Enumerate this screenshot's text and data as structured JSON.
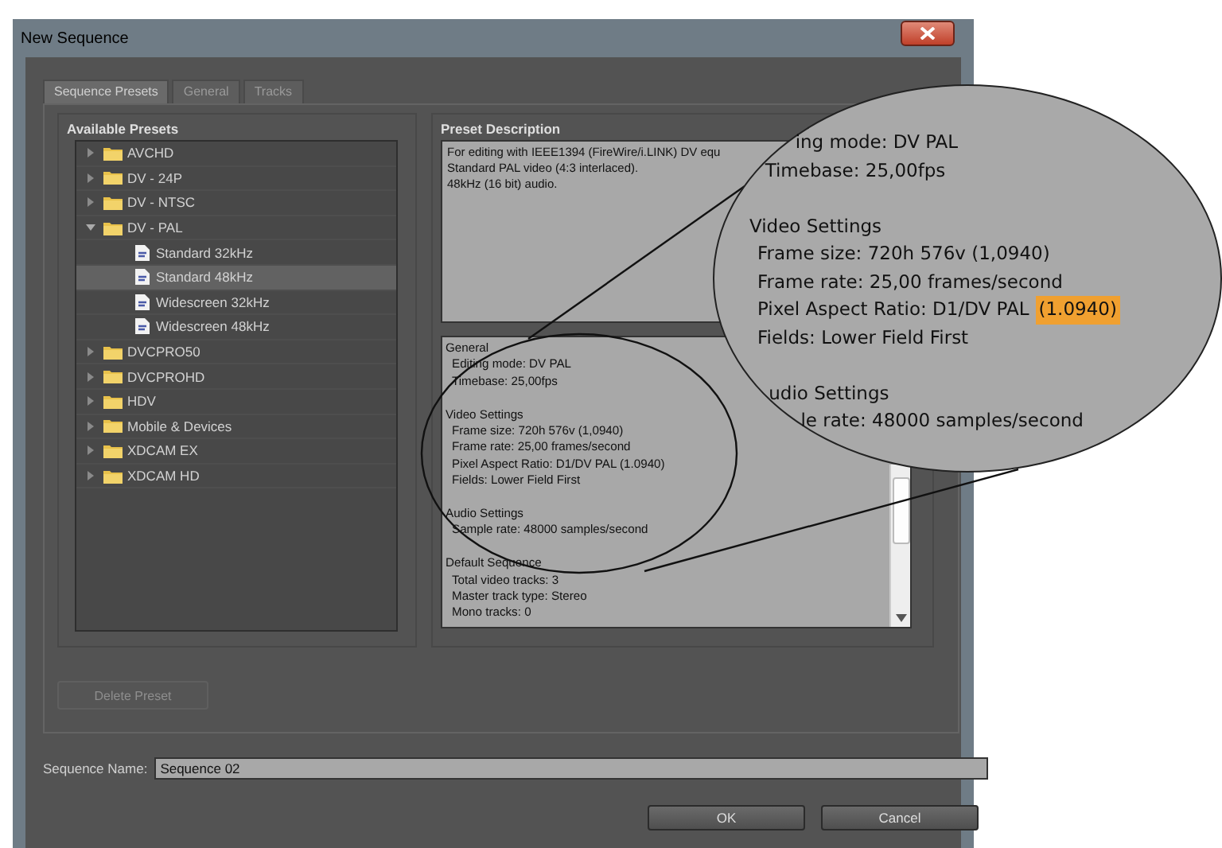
{
  "window": {
    "title": "New Sequence"
  },
  "tabs": [
    {
      "label": "Sequence Presets",
      "selected": true
    },
    {
      "label": "General",
      "selected": false
    },
    {
      "label": "Tracks",
      "selected": false
    }
  ],
  "presets": {
    "heading": "Available Presets",
    "tree": [
      {
        "kind": "folder",
        "label": "AVCHD",
        "expanded": false,
        "selected": false
      },
      {
        "kind": "folder",
        "label": "DV - 24P",
        "expanded": false,
        "selected": false
      },
      {
        "kind": "folder",
        "label": "DV - NTSC",
        "expanded": false,
        "selected": false
      },
      {
        "kind": "folder",
        "label": "DV - PAL",
        "expanded": true,
        "selected": false,
        "children": [
          {
            "kind": "preset",
            "label": "Standard 32kHz",
            "selected": false
          },
          {
            "kind": "preset",
            "label": "Standard 48kHz",
            "selected": true
          },
          {
            "kind": "preset",
            "label": "Widescreen 32kHz",
            "selected": false
          },
          {
            "kind": "preset",
            "label": "Widescreen 48kHz",
            "selected": false
          }
        ]
      },
      {
        "kind": "folder",
        "label": "DVCPRO50",
        "expanded": false,
        "selected": false
      },
      {
        "kind": "folder",
        "label": "DVCPROHD",
        "expanded": false,
        "selected": false
      },
      {
        "kind": "folder",
        "label": "HDV",
        "expanded": false,
        "selected": false
      },
      {
        "kind": "folder",
        "label": "Mobile & Devices",
        "expanded": false,
        "selected": false
      },
      {
        "kind": "folder",
        "label": "XDCAM EX",
        "expanded": false,
        "selected": false
      },
      {
        "kind": "folder",
        "label": "XDCAM HD",
        "expanded": false,
        "selected": false
      }
    ]
  },
  "description": {
    "heading": "Preset Description",
    "summary": [
      "For editing with IEEE1394 (FireWire/i.LINK) DV equ",
      "Standard PAL video (4:3 interlaced).",
      "48kHz (16 bit) audio."
    ],
    "details": [
      {
        "heading": "General",
        "entries": [
          "Editing mode: DV PAL",
          "Timebase: 25,00fps"
        ]
      },
      {
        "heading": "Video Settings",
        "entries": [
          "Frame size: 720h 576v (1,0940)",
          "Frame rate: 25,00 frames/second",
          "Pixel Aspect Ratio: D1/DV PAL (1.0940)",
          "Fields: Lower Field First"
        ]
      },
      {
        "heading": "Audio Settings",
        "entries": [
          "Sample rate: 48000 samples/second"
        ]
      },
      {
        "heading": "Default Sequence",
        "entries": [
          "Total video tracks: 3",
          "Master track type: Stereo",
          "Mono tracks: 0"
        ]
      }
    ]
  },
  "delete_button": {
    "label": "Delete Preset",
    "disabled": true
  },
  "sequence_name": {
    "label": "Sequence Name:",
    "value": "Sequence 02"
  },
  "buttons": [
    "OK",
    "Cancel"
  ],
  "magnifier": {
    "groups": [
      {
        "entries": [
          {
            "text": "ing mode: DV PAL"
          },
          {
            "text": "Timebase: 25,00fps"
          }
        ]
      },
      {
        "heading": "Video Settings",
        "entries": [
          {
            "text": "Frame size: 720h 576v (1,0940)"
          },
          {
            "text": "Frame rate: 25,00 frames/second"
          },
          {
            "text": "Pixel Aspect Ratio: D1/DV PAL",
            "highlight": "(1.0940)"
          },
          {
            "text": "Fields: Lower Field First"
          }
        ]
      },
      {
        "heading": "udio Settings",
        "entries": [
          {
            "text": "le rate: 48000 samples/second"
          }
        ]
      }
    ]
  }
}
